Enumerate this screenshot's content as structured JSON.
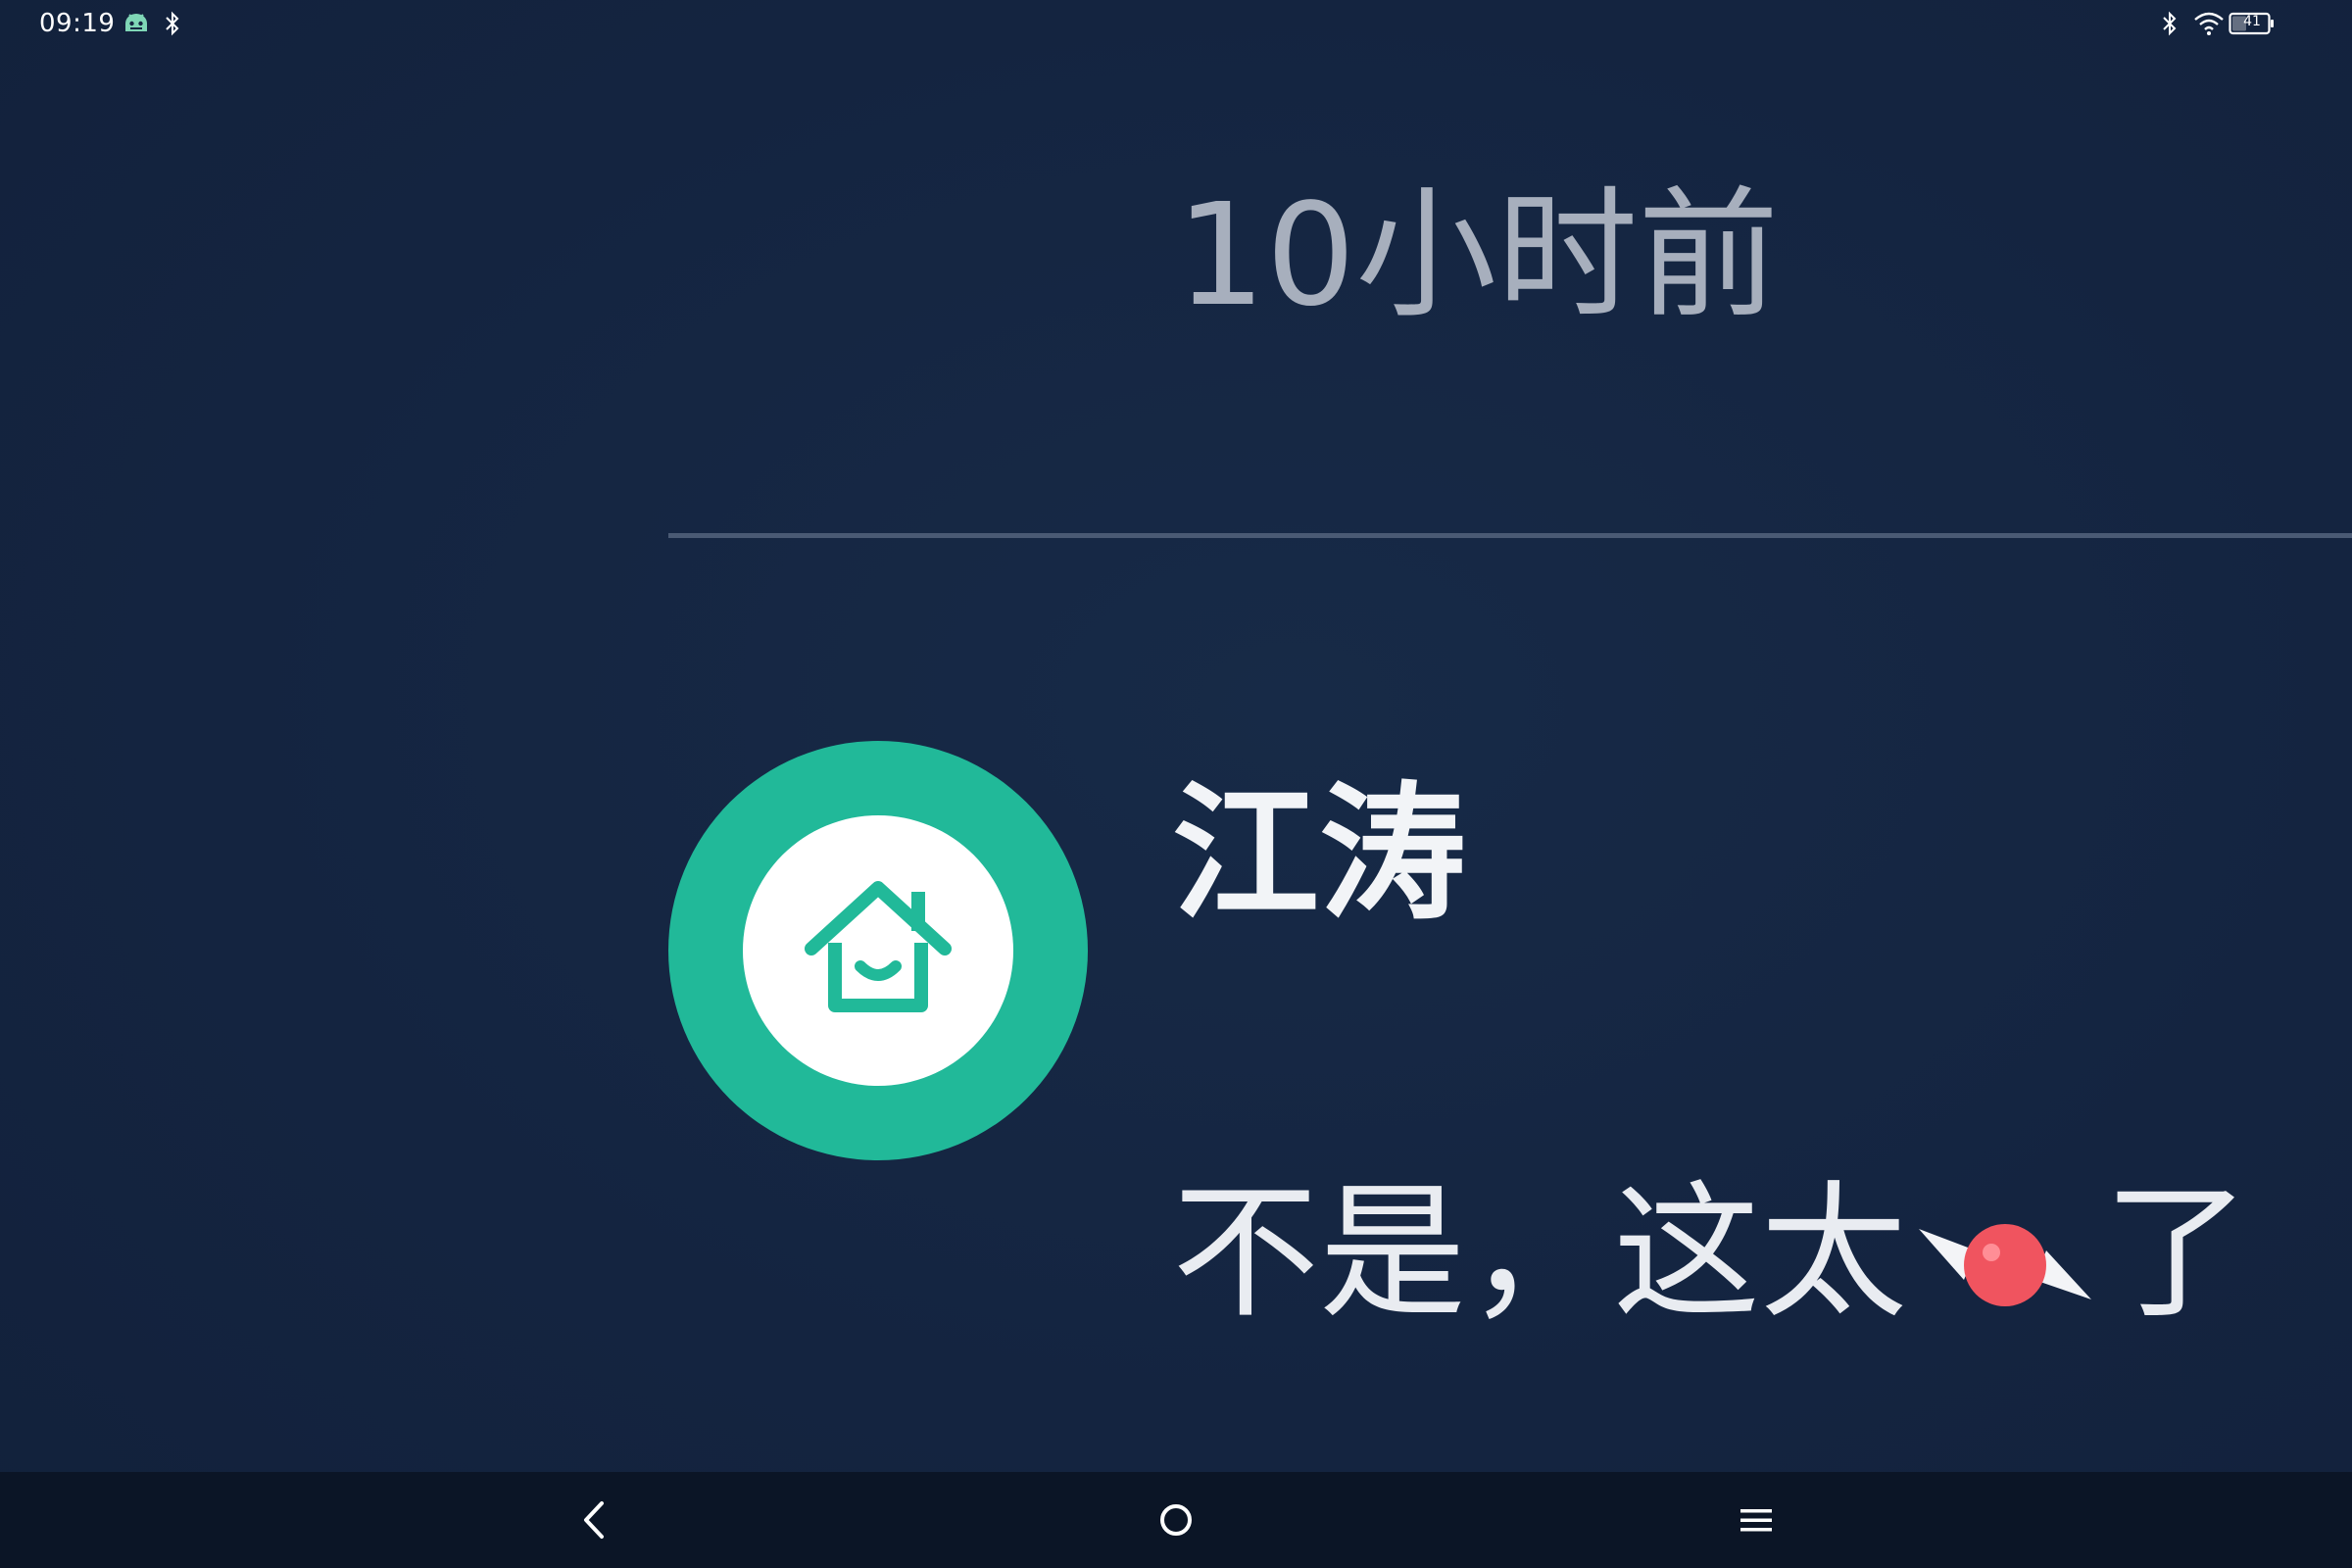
{
  "status_bar": {
    "time": "09:19",
    "app_icon": "android-bot-icon",
    "bluetooth_icon": "bluetooth-icon",
    "wifi_icon": "wifi-icon",
    "battery_level": "41"
  },
  "message_list": {
    "previous_item": {
      "timestamp": "10小时前"
    },
    "item": {
      "avatar_icon": "home-icon",
      "avatar_color": "#21b999",
      "username": "江涛",
      "message_text_before": "不是，这太",
      "message_emoji": "candy-icon",
      "message_text_after": "了"
    }
  },
  "nav_bar": {
    "back_icon": "back-chevron-icon",
    "home_icon": "home-circle-icon",
    "menu_icon": "menu-icon"
  },
  "colors": {
    "background": "#152540",
    "nav_background": "#0b1526",
    "accent": "#21b999",
    "timestamp_text": "#a7afbd",
    "divider": "#4a5a74"
  }
}
